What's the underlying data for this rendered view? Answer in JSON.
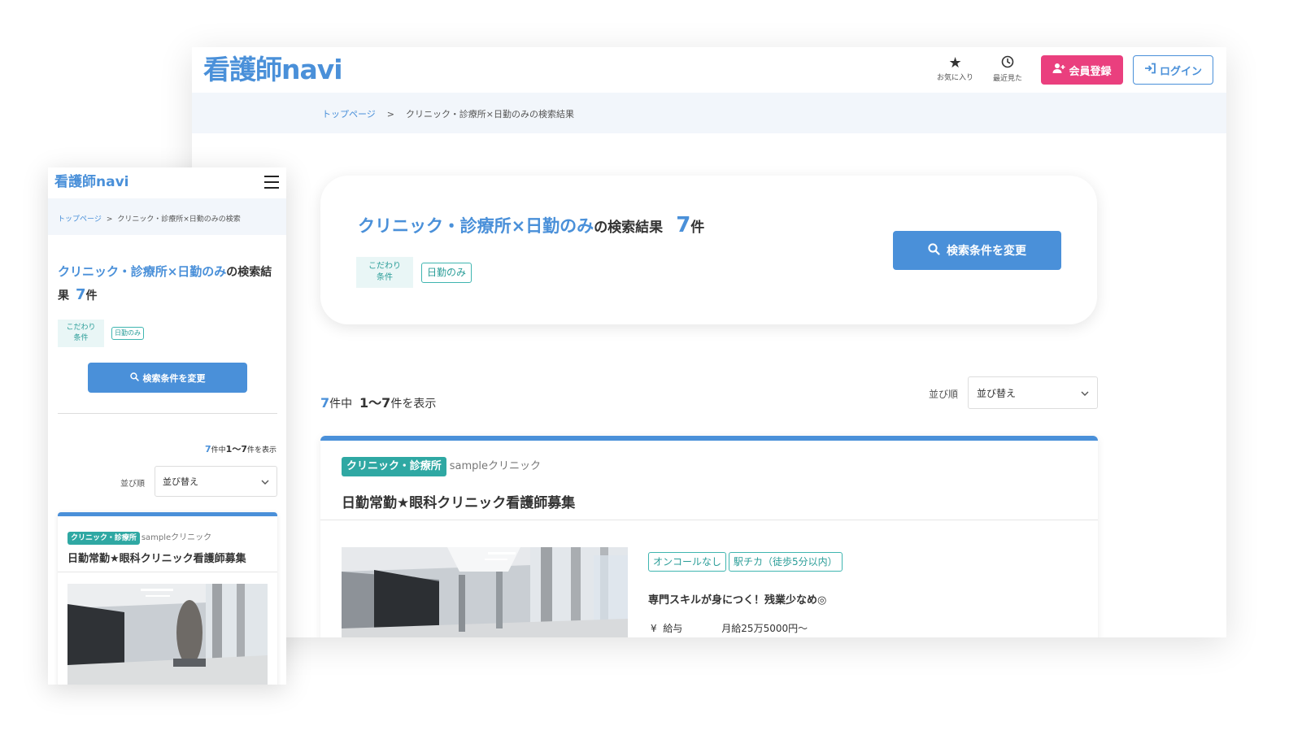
{
  "brand": {
    "logo": "看護師navi",
    "accent": "#4a90d9",
    "pink": "#ea3f7e",
    "teal": "#2fa8a3"
  },
  "header": {
    "favorites_label": "お気に入り",
    "recent_label": "最近見た",
    "register_label": "会員登録",
    "login_label": "ログイン"
  },
  "breadcrumb": {
    "home": "トップページ",
    "separator": ">",
    "current": "クリニック・診療所×日勤のみの検索結果",
    "current_mobile": "クリニック・診療所×日勤のみの検索"
  },
  "search": {
    "query": "クリニック・診療所×日勤のみ",
    "suffix": "の検索結果",
    "count": "7",
    "unit": "件",
    "pref_label_line1": "こだわり",
    "pref_label_line2": "条件",
    "tag": "日勤のみ",
    "change_button": "検索条件を変更"
  },
  "results": {
    "total": "7",
    "total_unit": "件中",
    "range": "1〜7",
    "range_suffix": "件を表示"
  },
  "sort": {
    "label": "並び順",
    "selected": "並び替え"
  },
  "job": {
    "category": "クリニック・診療所",
    "clinic": "sampleクリニック",
    "title": "日勤常勤★眼科クリニック看護師募集",
    "tags": [
      "オンコールなし",
      "駅チカ（徒歩5分以内）"
    ],
    "catch": "専門スキルが身につく！残業少なめ◎",
    "salary_label": "給与",
    "salary_value": "月給25万5000円〜"
  }
}
